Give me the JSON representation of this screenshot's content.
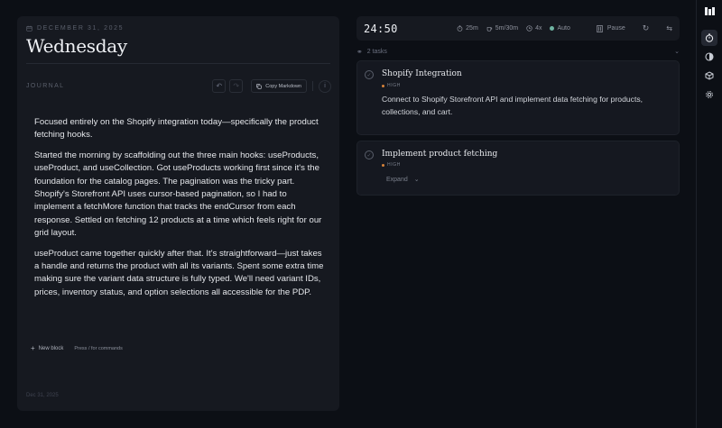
{
  "journal": {
    "date": "DECEMBER 31, 2025",
    "day": "Wednesday",
    "section_label": "JOURNAL",
    "copy_label": "Copy Markdown",
    "paragraphs": [
      "Focused entirely on the Shopify integration today—specifically the product fetching hooks.",
      "Started the morning by scaffolding out the three main hooks: useProducts, useProduct, and useCollection. Got useProducts working first since it's the foundation for the catalog pages. The pagination was the tricky part. Shopify's Storefront API uses cursor-based pagination, so I had to implement a fetchMore function that tracks the endCursor from each response. Settled on fetching 12 products at a time which feels right for our grid layout.",
      "useProduct came together quickly after that. It's straightforward—just takes a handle and returns the product with all its variants. Spent some extra time making sure the variant data structure is fully typed. We'll need variant IDs, prices, inventory status, and option selections all accessible for the PDP."
    ],
    "new_block_label": "New block",
    "new_block_hint": "Press / for commands",
    "footer_date": "Dec 31, 2025"
  },
  "timer": {
    "value": "24:50",
    "focus": "25m",
    "breaks": "5m/30m",
    "cycles": "4x",
    "mode": "Auto",
    "pause_label": "Pause"
  },
  "tasks_header": {
    "count_label": "2 tasks"
  },
  "tasks": [
    {
      "title": "Shopify Integration",
      "priority": "HIGH",
      "description": "Connect to Shopify Storefront API and implement data fetching for products, collections, and cart."
    },
    {
      "title": "Implement product fetching",
      "priority": "HIGH",
      "expand_label": "Expand"
    }
  ],
  "icons": {
    "logo": "brand-logo",
    "nav": [
      "timer-icon",
      "half-circle-icon",
      "cube-icon",
      "gear-icon"
    ]
  },
  "colors": {
    "background": "#0c0f15",
    "panel": "#161920",
    "priority_high": "#d8833a",
    "auto_indicator": "#6fb3a2"
  }
}
